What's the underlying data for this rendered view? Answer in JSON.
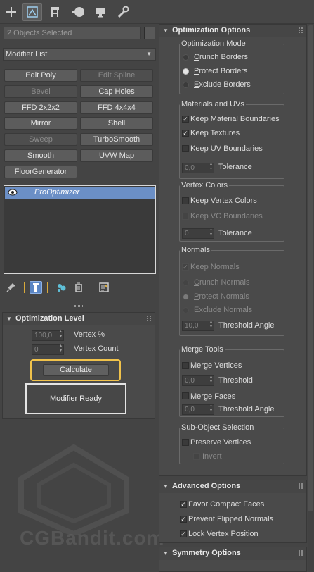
{
  "tabs": [
    {
      "icon": "plus-icon"
    },
    {
      "icon": "modify-icon",
      "active": true
    },
    {
      "icon": "hierarchy-icon"
    },
    {
      "icon": "motion-icon"
    },
    {
      "icon": "display-icon"
    },
    {
      "icon": "utilities-icon"
    }
  ],
  "object_selection": "2 Objects Selected",
  "modifier_list": "Modifier List",
  "modifier_buttons": {
    "edit_poly": "Edit Poly",
    "edit_spline": "Edit Spline",
    "bevel": "Bevel",
    "cap_holes": "Cap Holes",
    "ffd_2": "FFD 2x2x2",
    "ffd_4": "FFD 4x4x4",
    "mirror": "Mirror",
    "shell": "Shell",
    "sweep": "Sweep",
    "turbosmooth": "TurboSmooth",
    "smooth": "Smooth",
    "uvw_map": "UVW Map",
    "floorgenerator": "FloorGenerator"
  },
  "stack": {
    "item": "ProOptimizer"
  },
  "optimization_level": {
    "title": "Optimization Level",
    "vertex_pct_value": "100,0",
    "vertex_pct_label": "Vertex %",
    "vertex_count_value": "0",
    "vertex_count_label": "Vertex Count",
    "calculate": "Calculate",
    "status": "Modifier Ready"
  },
  "optimization_options": {
    "title": "Optimization Options",
    "mode": {
      "title": "Optimization Mode",
      "crunch_first": "C",
      "crunch_rest": "runch Borders",
      "protect_first": "P",
      "protect_rest": "rotect Borders",
      "exclude_first": "E",
      "exclude_rest": "xclude Borders"
    },
    "materials": {
      "title": "Materials and UVs",
      "keep_material": "Keep Material Boundaries",
      "keep_textures": "Keep Textures",
      "keep_uv": "Keep UV Boundaries",
      "tolerance_value": "0,0",
      "tolerance_label": "Tolerance"
    },
    "vertex_colors": {
      "title": "Vertex Colors",
      "keep_vc": "Keep Vertex Colors",
      "keep_vc_boundaries": "Keep VC Boundaries",
      "tolerance_value": "0",
      "tolerance_label": "Tolerance"
    },
    "normals": {
      "title": "Normals",
      "keep_normals": "Keep Normals",
      "crunch_first": "C",
      "crunch_rest": "runch Normals",
      "protect_first": "P",
      "protect_rest": "rotect Normals",
      "exclude_first": "E",
      "exclude_rest": "xclude Normals",
      "threshold_value": "10,0",
      "threshold_label": "Threshold Angle"
    },
    "merge_tools": {
      "title": "Merge Tools",
      "merge_vertices": "Merge Vertices",
      "threshold_value": "0,0",
      "threshold_label": "Threshold",
      "merge_faces": "Merge Faces",
      "angle_value": "0,0",
      "angle_label": "Threshold Angle"
    },
    "subobject": {
      "title": "Sub-Object Selection",
      "preserve": "Preserve Vertices",
      "invert": "Invert"
    }
  },
  "advanced_options": {
    "title": "Advanced Options",
    "favor_compact": "Favor Compact Faces",
    "prevent_flipped": "Prevent Flipped Normals",
    "lock_vertex": "Lock Vertex Position"
  },
  "symmetry_options": {
    "title": "Symmetry Options"
  },
  "watermark": "CGBandit.com"
}
